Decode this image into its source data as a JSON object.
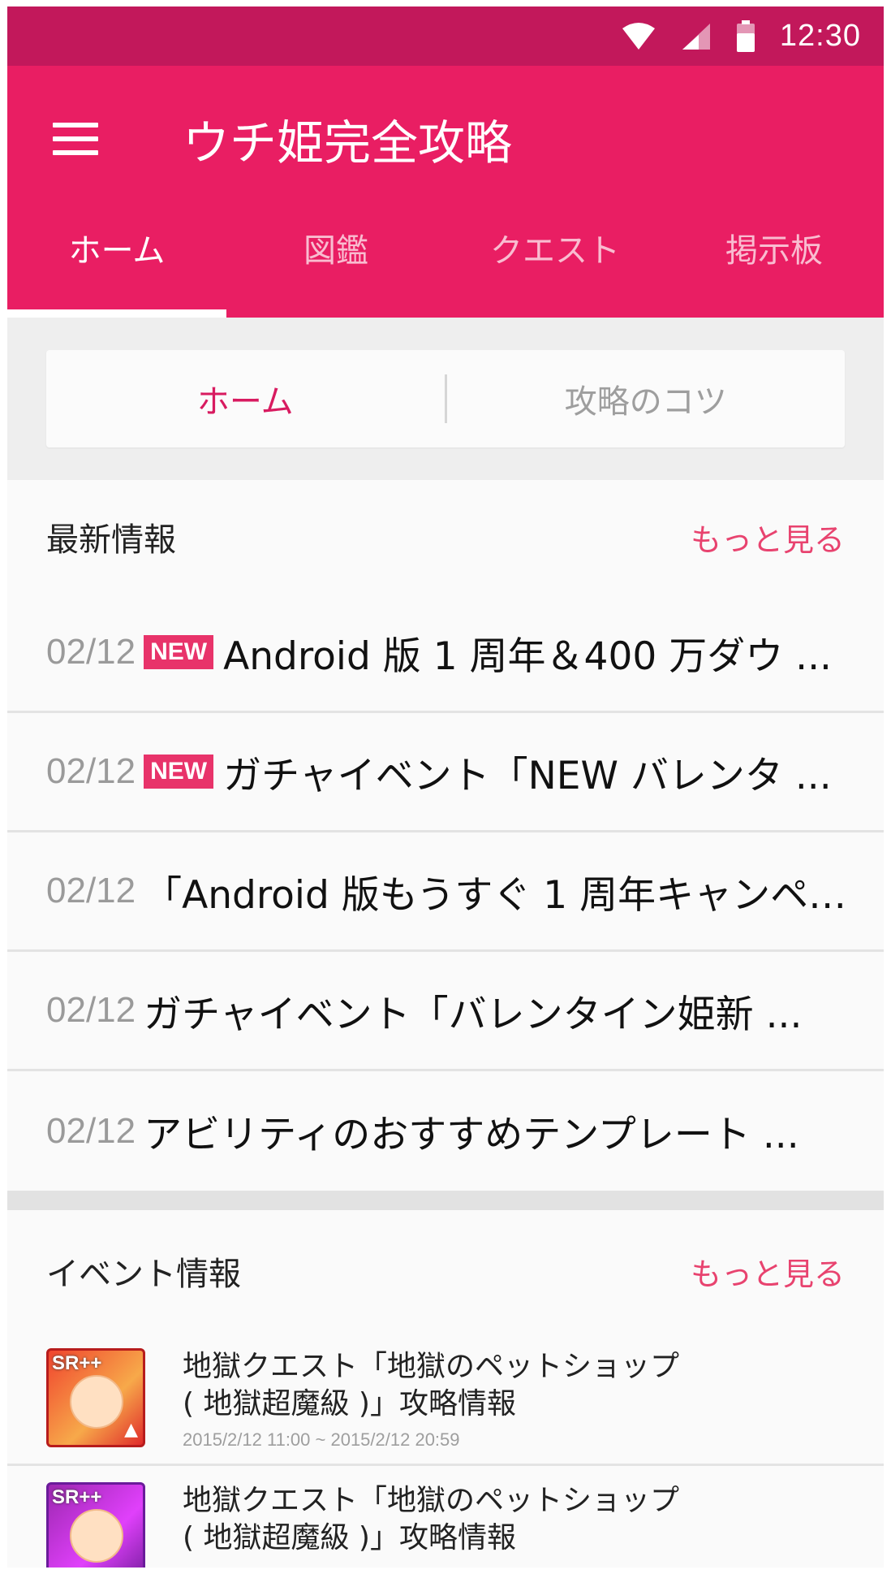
{
  "status_bar": {
    "time": "12:30",
    "icons": [
      "wifi-icon",
      "signal-icon",
      "battery-icon"
    ]
  },
  "app_bar": {
    "title": "ウチ姫完全攻略",
    "tabs": [
      {
        "label": "ホーム",
        "active": true
      },
      {
        "label": "図鑑",
        "active": false
      },
      {
        "label": "クエスト",
        "active": false
      },
      {
        "label": "掲示板",
        "active": false
      }
    ]
  },
  "segment": {
    "items": [
      {
        "label": "ホーム",
        "active": true
      },
      {
        "label": "攻略のコツ",
        "active": false
      }
    ]
  },
  "latest": {
    "heading": "最新情報",
    "more_label": "もっと見る",
    "items": [
      {
        "date": "02/12",
        "badge": "NEW",
        "text": "Android 版 1 周年＆400 万ダウ ..."
      },
      {
        "date": "02/12",
        "badge": "NEW",
        "text": "ガチャイベント「NEW バレンタ ..."
      },
      {
        "date": "02/12",
        "badge": "",
        "text": "「Android 版もうすぐ 1 周年キャンペ ..."
      },
      {
        "date": "02/12",
        "badge": "",
        "text": "ガチャイベント「バレンタイン姫新 ..."
      },
      {
        "date": "02/12",
        "badge": "",
        "text": "アビリティのおすすめテンプレート ..."
      }
    ]
  },
  "events": {
    "heading": "イベント情報",
    "more_label": "もっと見る",
    "items": [
      {
        "badge": "SR++",
        "line1": "地獄クエスト「地獄のペットショップ",
        "line2": "( 地獄超魔級 )」攻略情報",
        "period": "2015/2/12 11:00 ~ 2015/2/12 20:59",
        "color": "#f0442e"
      },
      {
        "badge": "SR++",
        "line1": "地獄クエスト「地獄のペットショップ",
        "line2": "( 地獄超魔級 )」攻略情報",
        "period": "",
        "color": "#9c27b0"
      }
    ]
  },
  "colors": {
    "primary": "#e91e63",
    "primary_dark": "#c2185b",
    "accent": "#e8436f",
    "badge": "#e8336a"
  }
}
